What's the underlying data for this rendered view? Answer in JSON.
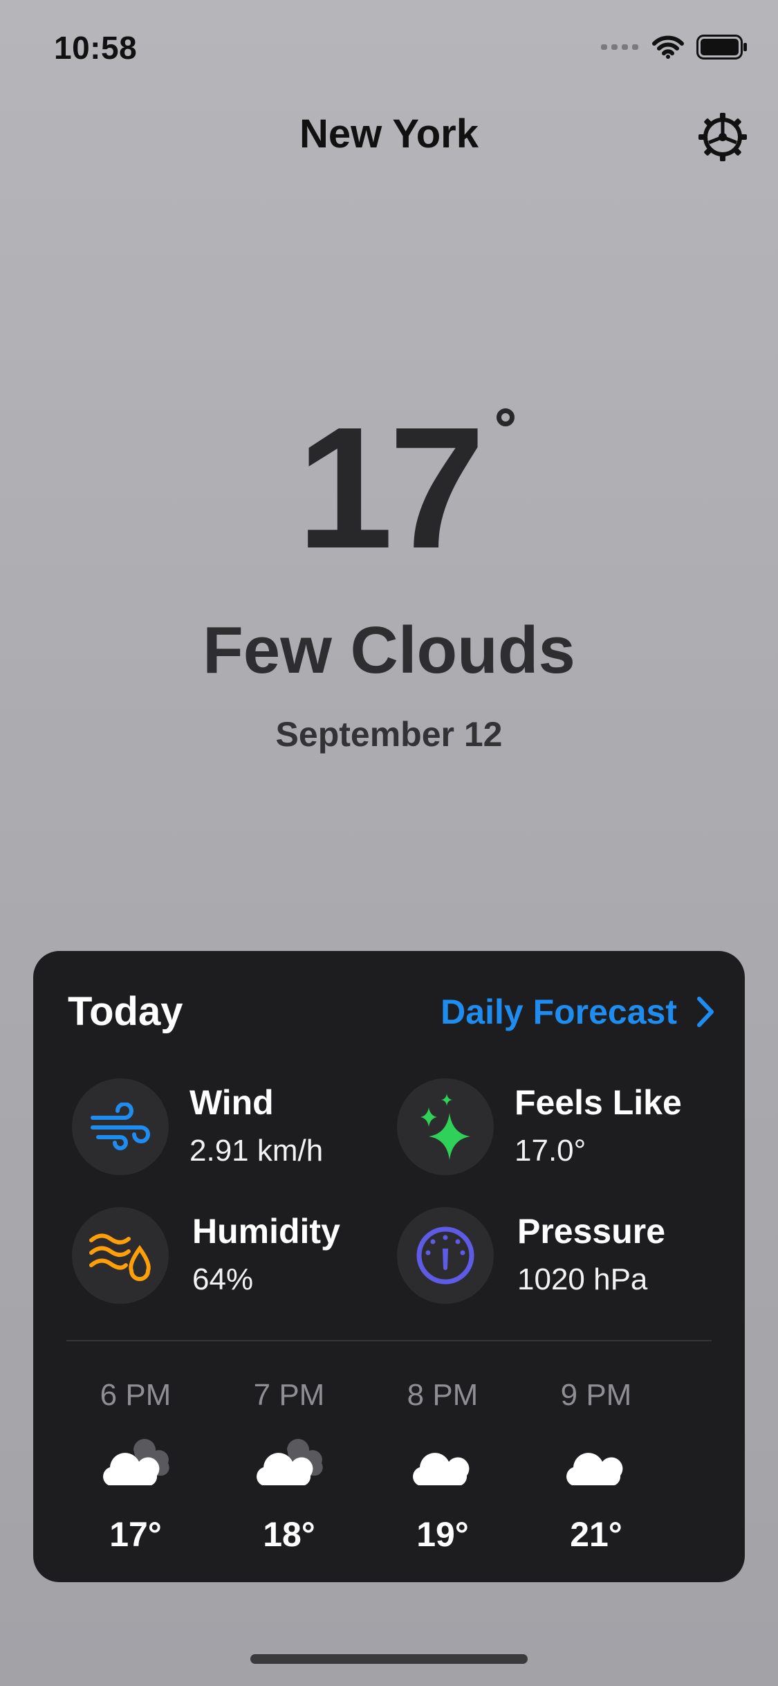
{
  "status_bar": {
    "time": "10:58",
    "icons": [
      "signal-dots-icon",
      "wifi-icon",
      "battery-icon"
    ]
  },
  "header": {
    "city": "New York",
    "settings_icon": "gear-icon"
  },
  "current": {
    "temperature": "17",
    "condition": "Few Clouds",
    "date": "September 12"
  },
  "today_card": {
    "title": "Today",
    "forecast_link": "Daily Forecast",
    "metrics": {
      "wind": {
        "label": "Wind",
        "value": "2.91 km/h",
        "icon": "wind-icon",
        "color": "#1f8cf0"
      },
      "feels_like": {
        "label": "Feels Like",
        "value": "17.0°",
        "icon": "sparkles-icon",
        "color": "#30d158"
      },
      "humidity": {
        "label": "Humidity",
        "value": "64%",
        "icon": "humidity-icon",
        "color": "#ff9f0a"
      },
      "pressure": {
        "label": "Pressure",
        "value": "1020 hPa",
        "icon": "gauge-icon",
        "color": "#5e5ce6"
      }
    },
    "hourly": [
      {
        "time": "6 PM",
        "temp": "17°",
        "icon": "cloud-partly-icon"
      },
      {
        "time": "7 PM",
        "temp": "18°",
        "icon": "cloud-partly-icon"
      },
      {
        "time": "8 PM",
        "temp": "19°",
        "icon": "cloud-icon"
      },
      {
        "time": "9 PM",
        "temp": "21°",
        "icon": "cloud-icon"
      }
    ]
  }
}
